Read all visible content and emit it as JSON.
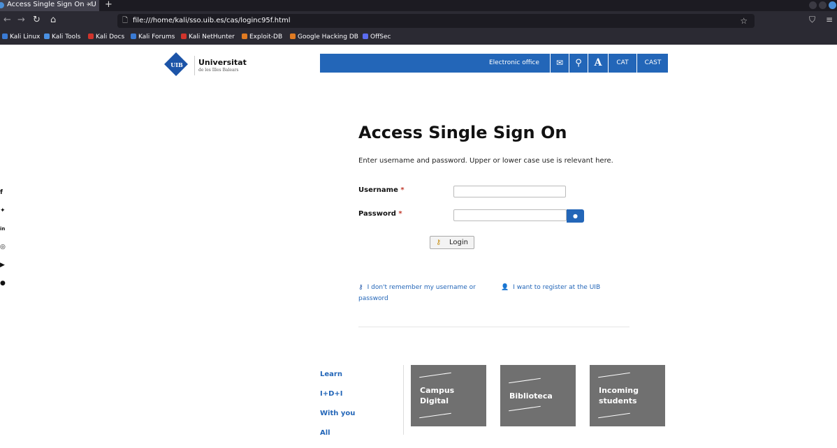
{
  "browser": {
    "tab_title": "Access Single Sign On - U",
    "tab_close": "×",
    "new_tab": "+",
    "url": "file:///home/kali/sso.uib.es/cas/loginc95f.html",
    "bookmarks": [
      {
        "label": "Kali Linux",
        "color": "#3a7bd5"
      },
      {
        "label": "Kali Tools",
        "color": "#4a90e2"
      },
      {
        "label": "Kali Docs",
        "color": "#d0342c"
      },
      {
        "label": "Kali Forums",
        "color": "#3a7bd5"
      },
      {
        "label": "Kali NetHunter",
        "color": "#d0342c"
      },
      {
        "label": "Exploit-DB",
        "color": "#e07b22"
      },
      {
        "label": "Google Hacking DB",
        "color": "#e07b22"
      },
      {
        "label": "OffSec",
        "color": "#5b6cf0"
      }
    ]
  },
  "header": {
    "logo_mark": "UIB",
    "logo_name": "Universitat",
    "logo_sub": "de les Illes Balears",
    "electronic_office": "Electronic office",
    "lang_cat": "CAT",
    "lang_cast": "CAST",
    "font_button": "A",
    "accent": "#2366b8"
  },
  "social": [
    "facebook-icon",
    "twitter-icon",
    "linkedin-icon",
    "instagram-icon",
    "youtube-icon",
    "spotify-icon"
  ],
  "form": {
    "title": "Access Single Sign On",
    "intro": "Enter username and password. Upper or lower case use is relevant here.",
    "username_label": "Username",
    "password_label": "Password",
    "required_mark": "*",
    "login_label": "Login",
    "forgot_link": "I don't remember my username or password",
    "register_link": "I want to register at the UIB"
  },
  "footer": {
    "nav": [
      "Learn",
      "I+D+I",
      "With you",
      "All"
    ],
    "tiles": [
      {
        "line1": "Campus",
        "line2": "Digital"
      },
      {
        "line1": "Biblioteca",
        "line2": ""
      },
      {
        "line1": "Incoming",
        "line2": "students"
      }
    ]
  }
}
